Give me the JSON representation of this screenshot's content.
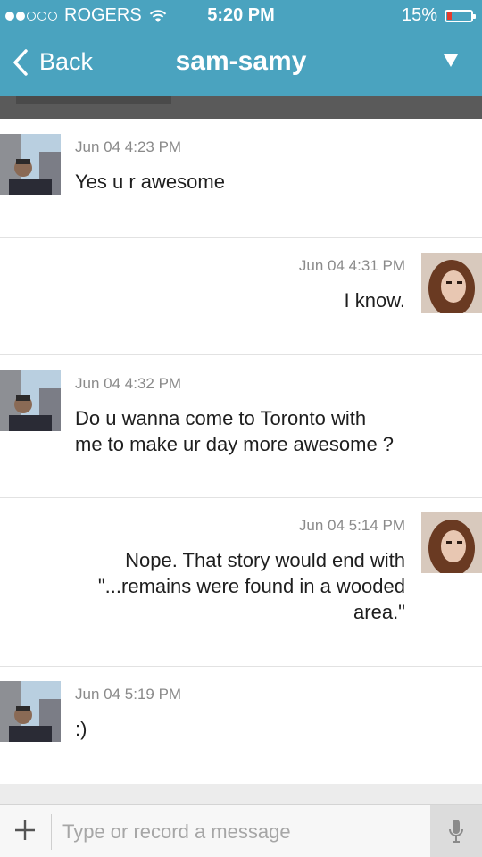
{
  "status": {
    "carrier": "ROGERS",
    "time": "5:20 PM",
    "battery": "15%",
    "signal_bars": 2
  },
  "nav": {
    "back_label": "Back",
    "title": "sam-samy"
  },
  "messages": [
    {
      "direction": "in",
      "timestamp": "Jun 04 4:23 PM",
      "text": "Yes u r awesome"
    },
    {
      "direction": "out",
      "timestamp": "Jun 04 4:31 PM",
      "text": "I know."
    },
    {
      "direction": "in",
      "timestamp": "Jun 04 4:32 PM",
      "text": "Do u wanna come to Toronto with\nme to make ur day more awesome ?"
    },
    {
      "direction": "out",
      "timestamp": "Jun 04 5:14 PM",
      "text": "Nope. That story would end with\n\"...remains were found in a wooded\narea.\""
    },
    {
      "direction": "in",
      "timestamp": "Jun 04 5:19 PM",
      "text": ":)"
    }
  ],
  "composer": {
    "placeholder": "Type or record a message"
  },
  "colors": {
    "accent": "#4aa3bf",
    "battery_low": "#e53b2c"
  },
  "icons": [
    "back-chevron-icon",
    "dropdown-caret-icon",
    "wifi-icon",
    "battery-icon",
    "plus-icon",
    "microphone-icon"
  ]
}
